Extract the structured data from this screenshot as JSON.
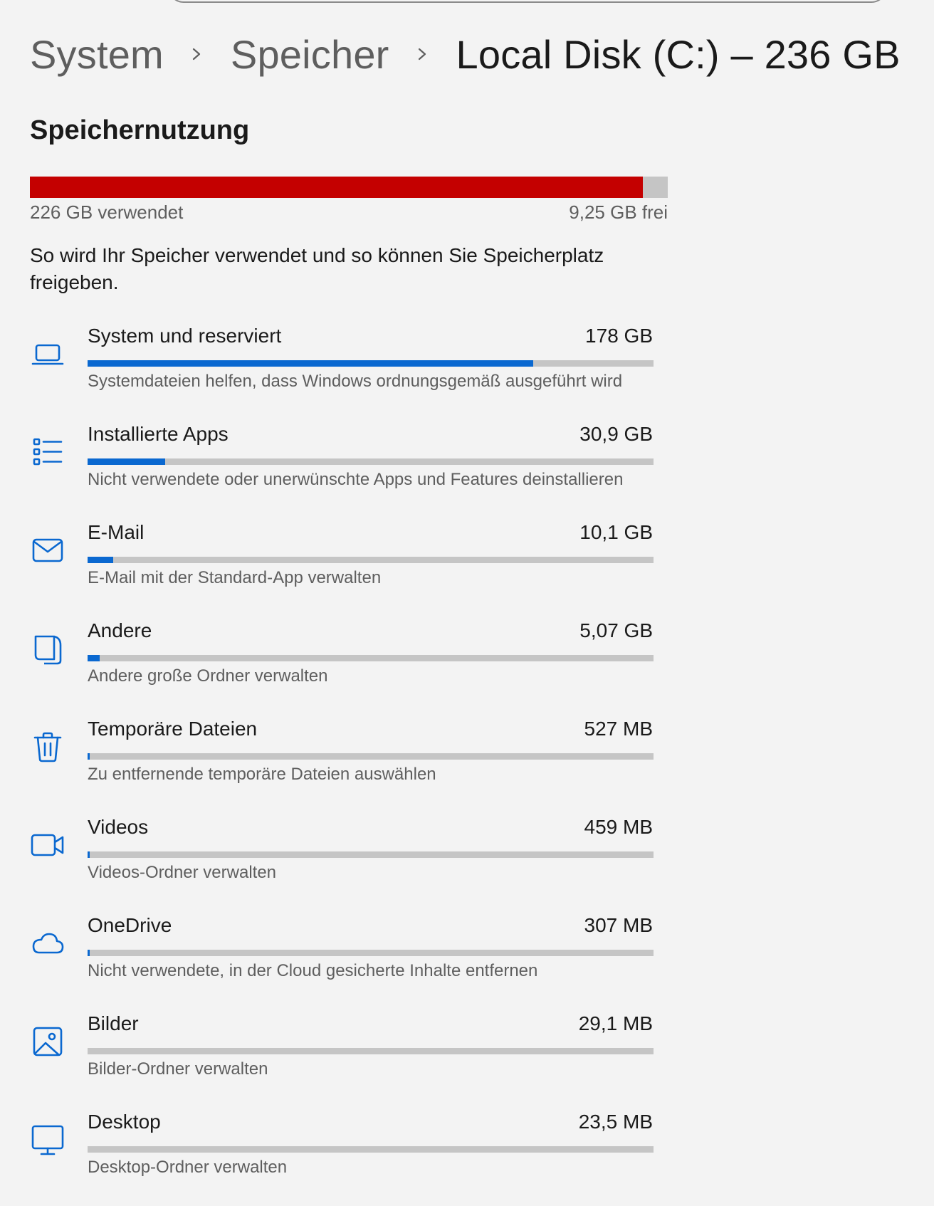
{
  "breadcrumb": {
    "items": [
      "System",
      "Speicher",
      "Local Disk (C:) – 236 GB"
    ]
  },
  "section_title": "Speichernutzung",
  "usage": {
    "used_label": "226 GB verwendet",
    "free_label": "9,25 GB frei",
    "used_fraction": 0.961,
    "bar_color": "#c40000"
  },
  "intro": "So wird Ihr Speicher verwendet und so können Sie Speicherplatz freigeben.",
  "accent_color": "#0a68d0",
  "categories": [
    {
      "label": "System und reserviert",
      "size": "178 GB",
      "description": "Systemdateien helfen, dass Windows ordnungsgemäß ausgeführt wird",
      "fraction": 0.787,
      "icon": "laptop-icon"
    },
    {
      "label": "Installierte Apps",
      "size": "30,9 GB",
      "description": "Nicht verwendete oder unerwünschte Apps und Features deinstallieren",
      "fraction": 0.137,
      "icon": "apps-list-icon"
    },
    {
      "label": "E-Mail",
      "size": "10,1 GB",
      "description": "E-Mail mit der Standard-App verwalten",
      "fraction": 0.045,
      "icon": "mail-icon"
    },
    {
      "label": "Andere",
      "size": "5,07 GB",
      "description": "Andere große Ordner verwalten",
      "fraction": 0.022,
      "icon": "document-icon"
    },
    {
      "label": "Temporäre Dateien",
      "size": "527 MB",
      "description": "Zu entfernende temporäre Dateien auswählen",
      "fraction": 0.003,
      "icon": "trash-icon"
    },
    {
      "label": "Videos",
      "size": "459 MB",
      "description": "Videos-Ordner verwalten",
      "fraction": 0.003,
      "icon": "video-camera-icon"
    },
    {
      "label": "OneDrive",
      "size": "307 MB",
      "description": "Nicht verwendete, in der Cloud gesicherte Inhalte entfernen",
      "fraction": 0.002,
      "icon": "cloud-icon"
    },
    {
      "label": "Bilder",
      "size": "29,1 MB",
      "description": "Bilder-Ordner verwalten",
      "fraction": 0.0,
      "icon": "image-icon"
    },
    {
      "label": "Desktop",
      "size": "23,5 MB",
      "description": "Desktop-Ordner verwalten",
      "fraction": 0.0,
      "icon": "monitor-icon"
    }
  ]
}
